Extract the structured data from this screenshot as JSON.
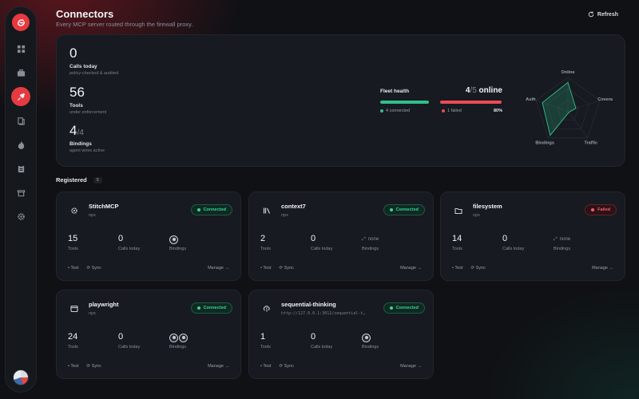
{
  "header": {
    "title": "Connectors",
    "subtitle": "Every MCP server routed through the firewall proxy.",
    "refresh_label": "Refresh"
  },
  "sidebar": {
    "items": [
      {
        "icon": "grid-icon",
        "active": false
      },
      {
        "icon": "briefcase-icon",
        "active": false
      },
      {
        "icon": "plug-icon",
        "active": true
      },
      {
        "icon": "book-icon",
        "active": false
      },
      {
        "icon": "flame-icon",
        "active": false
      },
      {
        "icon": "clipboard-icon",
        "active": false
      },
      {
        "icon": "store-icon",
        "active": false
      },
      {
        "icon": "gear-icon",
        "active": false
      }
    ]
  },
  "overview": {
    "calls": {
      "value": "0",
      "label": "Calls today",
      "sub": "policy-checked & audited"
    },
    "tools": {
      "value": "56",
      "label": "Tools",
      "sub": "under enforcement"
    },
    "bindings": {
      "value": "4",
      "total": "/4",
      "label": "Bindings",
      "sub": "agent wires active"
    },
    "fleet": {
      "title": "Fleet health",
      "online": "4",
      "total": "/5",
      "online_word": "online",
      "connected_label": "4 connected",
      "failed_label": "1 failed",
      "percent": "80%",
      "connected_fraction": 0.8
    },
    "radar": {
      "axes": [
        "Online",
        "Covera",
        "Traffic",
        "Bindings",
        "Auth"
      ],
      "values": [
        0.85,
        0.25,
        0.05,
        0.9,
        0.8
      ]
    }
  },
  "registered": {
    "title": "Registered",
    "count": "5"
  },
  "connectors": [
    {
      "name": "StitchMCP",
      "sub": "npx",
      "icon": "cog-icon",
      "status": "Connected",
      "status_kind": "ok",
      "tools": "15",
      "calls": "0",
      "bindings": "icons",
      "binding_count": 1
    },
    {
      "name": "context7",
      "sub": "npx",
      "icon": "library-icon",
      "status": "Connected",
      "status_kind": "ok",
      "tools": "2",
      "calls": "0",
      "bindings": "none",
      "binding_count": 0
    },
    {
      "name": "filesystem",
      "sub": "npx",
      "icon": "folder-icon",
      "status": "Failed",
      "status_kind": "bad",
      "tools": "14",
      "calls": "0",
      "bindings": "none",
      "binding_count": 0
    },
    {
      "name": "playwright",
      "sub": "npx",
      "icon": "browser-icon",
      "status": "Connected",
      "status_kind": "ok",
      "tools": "24",
      "calls": "0",
      "bindings": "icons",
      "binding_count": 2
    },
    {
      "name": "sequential-thinking",
      "sub": "http://127.0.0.1:3012/sequential-t…",
      "icon": "brain-icon",
      "status": "Connected",
      "status_kind": "ok",
      "tools": "1",
      "calls": "0",
      "bindings": "icons",
      "binding_count": 1
    }
  ],
  "labels": {
    "tools": "Tools",
    "calls": "Calls today",
    "bindings": "Bindings",
    "none": "none",
    "test": "Test",
    "sync": "Sync",
    "manage": "Manage"
  },
  "colors": {
    "accent": "#e53a40",
    "ok": "#2fbf8a",
    "bad": "#ec4b55",
    "background": "#0f1115",
    "panel": "#171a20"
  }
}
